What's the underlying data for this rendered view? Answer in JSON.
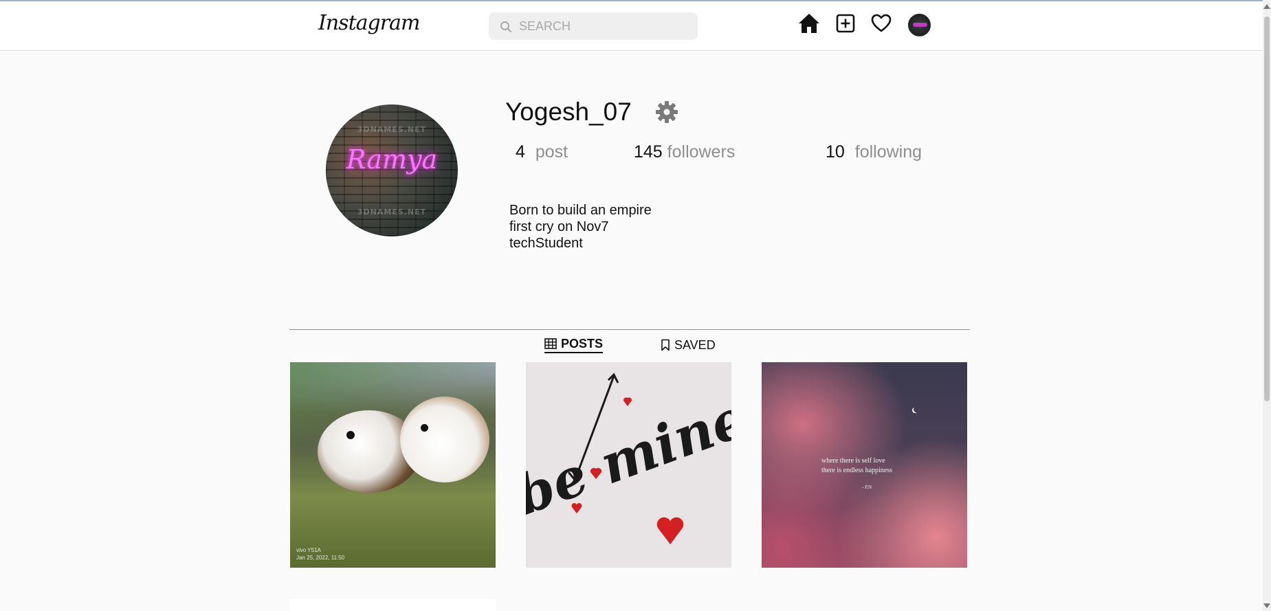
{
  "header": {
    "logo_text": "Instagram",
    "search_placeholder": "SEARCH",
    "icons": [
      "home-icon",
      "add-post-icon",
      "heart-icon",
      "avatar"
    ]
  },
  "profile": {
    "username": "Yogesh_07",
    "avatar_text": "Ramya",
    "stats": {
      "posts_count": "4",
      "posts_label": "post",
      "followers_count": "145",
      "followers_label": "followers",
      "following_count": "10",
      "following_label": "following"
    },
    "bio": [
      "Born to build an empire",
      "first cry on Nov7",
      "techStudent"
    ]
  },
  "tabs": [
    {
      "label": "POSTS",
      "icon": "grid-icon",
      "active": true
    },
    {
      "label": "SAVED",
      "icon": "bookmark-icon",
      "active": false
    }
  ],
  "posts": [
    {
      "description": "guinea pigs",
      "caption": "vivo Y51A",
      "timestamp": "Jan 25, 2022, 11:50"
    },
    {
      "description": "be mine",
      "text": "be mine"
    },
    {
      "description": "pink clouds night sky",
      "quote_line1": "where there is self love",
      "quote_line2": "there is endless happiness",
      "signature": "- P.N"
    }
  ],
  "colors": {
    "background": "#fafafa",
    "muted_text": "#8e8e8e",
    "neon_pink": "#f27cf5"
  }
}
